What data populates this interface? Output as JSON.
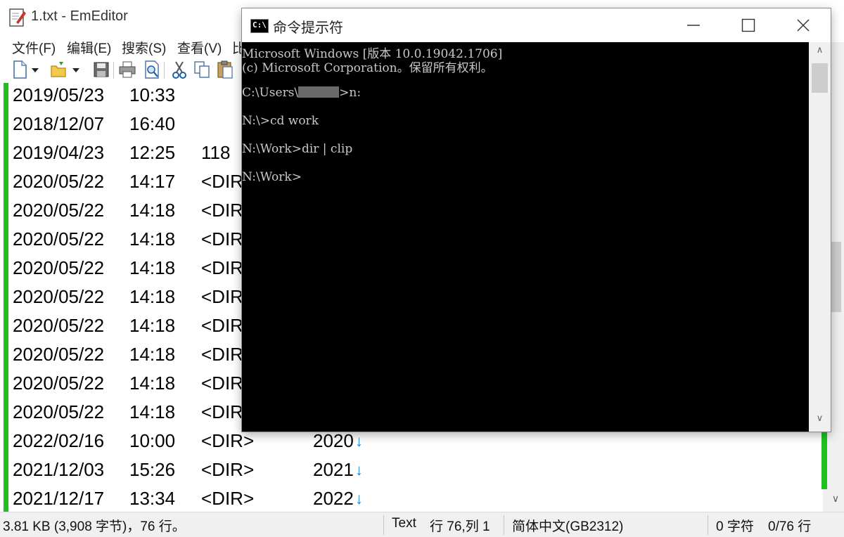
{
  "emeditor": {
    "title": "1.txt - EmEditor",
    "menu": [
      "文件(F)",
      "编辑(E)",
      "搜索(S)",
      "查看(V)",
      "比"
    ],
    "lines": [
      {
        "date": "2019/05/23",
        "time": "10:33",
        "type": "",
        "name": ""
      },
      {
        "date": "2018/12/07",
        "time": "16:40",
        "type": "",
        "name": ""
      },
      {
        "date": "2019/04/23",
        "time": "12:25",
        "type": "118",
        "name": ""
      },
      {
        "date": "2020/05/22",
        "time": "14:17",
        "type": "<DIR",
        "name": ""
      },
      {
        "date": "2020/05/22",
        "time": "14:18",
        "type": "<DIR",
        "name": ""
      },
      {
        "date": "2020/05/22",
        "time": "14:18",
        "type": "<DIR",
        "name": ""
      },
      {
        "date": "2020/05/22",
        "time": "14:18",
        "type": "<DIR",
        "name": ""
      },
      {
        "date": "2020/05/22",
        "time": "14:18",
        "type": "<DIR",
        "name": ""
      },
      {
        "date": "2020/05/22",
        "time": "14:18",
        "type": "<DIR",
        "name": ""
      },
      {
        "date": "2020/05/22",
        "time": "14:18",
        "type": "<DIR",
        "name": ""
      },
      {
        "date": "2020/05/22",
        "time": "14:18",
        "type": "<DIR",
        "name": ""
      },
      {
        "date": "2020/05/22",
        "time": "14:18",
        "type": "<DIR",
        "name": ""
      },
      {
        "date": "2022/02/16",
        "time": "10:00",
        "type": "<DIR>",
        "name": "2020"
      },
      {
        "date": "2021/12/03",
        "time": "15:26",
        "type": "<DIR>",
        "name": "2021"
      },
      {
        "date": "2021/12/17",
        "time": "13:34",
        "type": "<DIR>",
        "name": "2022"
      }
    ],
    "newline_mark": "↓",
    "status": {
      "size": "3.81 KB (3,908 字节)，76 行。",
      "mode": "Text",
      "position": "行 76,列 1",
      "encoding": "简体中文(GB2312)",
      "selection": "0 字符",
      "count": "0/76 行"
    }
  },
  "cmd": {
    "title": "命令提示符",
    "lines": [
      "Microsoft Windows [版本 10.0.19042.1706]",
      "(c) Microsoft Corporation。保留所有权利。",
      "",
      "C:\\Users\\",
      "",
      "N:\\>cd work",
      "",
      "N:\\Work>dir | clip",
      "",
      "N:\\Work>"
    ],
    "user_prompt_suffix": ">n:",
    "icon_text": "C:\\",
    "scroll_up": "∧",
    "scroll_down": "∨"
  }
}
